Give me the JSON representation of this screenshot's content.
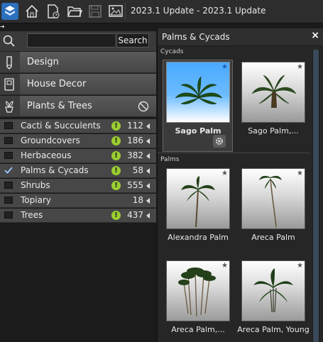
{
  "toolbar": {
    "title": "2023.1 Update - 2023.1 Update",
    "icons": [
      "app-logo-icon",
      "home-icon",
      "new-document-icon",
      "open-folder-icon",
      "save-icon",
      "picture-icon"
    ]
  },
  "search": {
    "placeholder": "",
    "value": "",
    "button_label": "Search"
  },
  "categories": [
    {
      "label": "Design",
      "icon": "pencil-icon"
    },
    {
      "label": "House Decor",
      "icon": "cabinet-icon"
    },
    {
      "label": "Plants & Trees",
      "icon": "plant-icon",
      "active": true
    }
  ],
  "subcategories": [
    {
      "name": "Cacti & Succulents",
      "count": "112",
      "alert": true,
      "checked": false
    },
    {
      "name": "Groundcovers",
      "count": "186",
      "alert": true,
      "checked": false
    },
    {
      "name": "Herbaceous",
      "count": "382",
      "alert": true,
      "checked": false
    },
    {
      "name": "Palms & Cycads",
      "count": "58",
      "alert": true,
      "checked": true
    },
    {
      "name": "Shrubs",
      "count": "555",
      "alert": true,
      "checked": false
    },
    {
      "name": "Topiary",
      "count": "18",
      "alert": false,
      "checked": false
    },
    {
      "name": "Trees",
      "count": "437",
      "alert": true,
      "checked": false
    }
  ],
  "library": {
    "title": "Palms & Cycads",
    "close": "×",
    "alert_glyph": "!",
    "sections": [
      {
        "name": "Cycads",
        "items": [
          {
            "caption": "Sago Palm",
            "selected": true
          },
          {
            "caption": "Sago Palm,..."
          }
        ]
      },
      {
        "name": "Palms",
        "items": [
          {
            "caption": "Alexandra Palm"
          },
          {
            "caption": "Areca Palm"
          },
          {
            "caption": "Areca Palm,..."
          },
          {
            "caption": "Areca Palm, Young"
          }
        ]
      }
    ]
  },
  "colors": {
    "accent": "#2c6fbd",
    "alert": "#9acd32",
    "selected_bg": "#49a9ff"
  }
}
